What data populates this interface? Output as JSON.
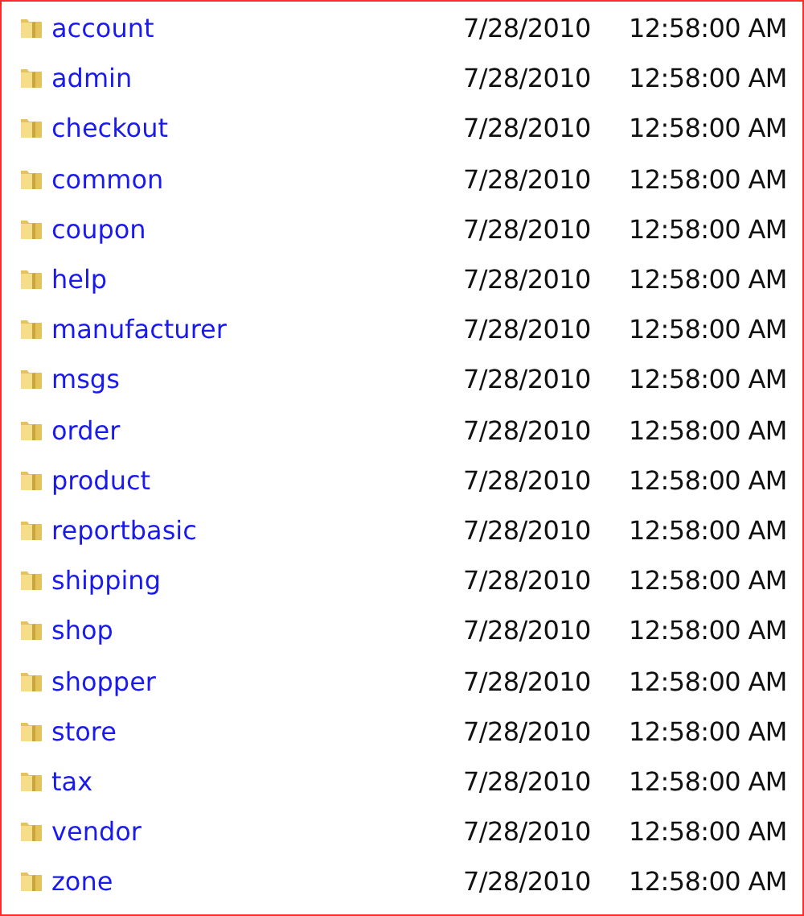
{
  "files": [
    {
      "name": "account",
      "date": "7/28/2010",
      "time": "12:58:00 AM"
    },
    {
      "name": "admin",
      "date": "7/28/2010",
      "time": "12:58:00 AM"
    },
    {
      "name": "checkout",
      "date": "7/28/2010",
      "time": "12:58:00 AM"
    },
    {
      "name": "common",
      "date": "7/28/2010",
      "time": "12:58:00 AM"
    },
    {
      "name": "coupon",
      "date": "7/28/2010",
      "time": "12:58:00 AM"
    },
    {
      "name": "help",
      "date": "7/28/2010",
      "time": "12:58:00 AM"
    },
    {
      "name": "manufacturer",
      "date": "7/28/2010",
      "time": "12:58:00 AM"
    },
    {
      "name": "msgs",
      "date": "7/28/2010",
      "time": "12:58:00 AM"
    },
    {
      "name": "order",
      "date": "7/28/2010",
      "time": "12:58:00 AM"
    },
    {
      "name": "product",
      "date": "7/28/2010",
      "time": "12:58:00 AM"
    },
    {
      "name": "reportbasic",
      "date": "7/28/2010",
      "time": "12:58:00 AM"
    },
    {
      "name": "shipping",
      "date": "7/28/2010",
      "time": "12:58:00 AM"
    },
    {
      "name": "shop",
      "date": "7/28/2010",
      "time": "12:58:00 AM"
    },
    {
      "name": "shopper",
      "date": "7/28/2010",
      "time": "12:58:00 AM"
    },
    {
      "name": "store",
      "date": "7/28/2010",
      "time": "12:58:00 AM"
    },
    {
      "name": "tax",
      "date": "7/28/2010",
      "time": "12:58:00 AM"
    },
    {
      "name": "vendor",
      "date": "7/28/2010",
      "time": "12:58:00 AM"
    },
    {
      "name": "zone",
      "date": "7/28/2010",
      "time": "12:58:00 AM"
    }
  ]
}
